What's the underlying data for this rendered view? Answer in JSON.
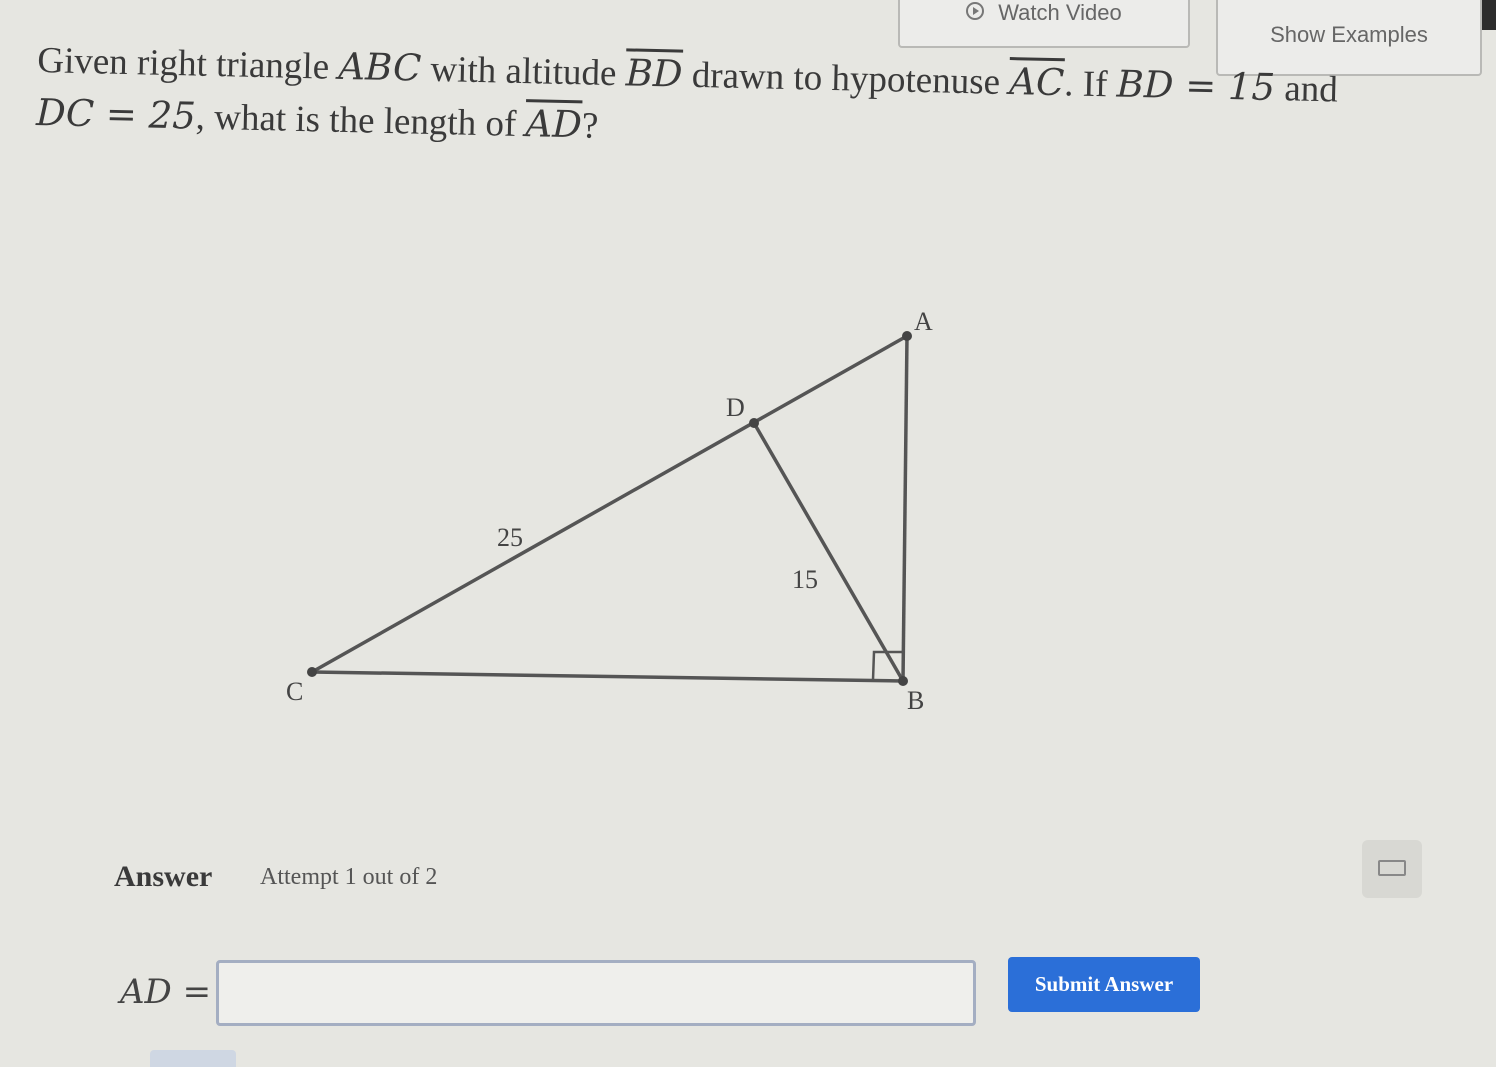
{
  "toolbar": {
    "watch_video_label": "Watch Video",
    "show_examples_label": "Show Examples"
  },
  "question": {
    "t1": "Given right triangle ",
    "m_abc": "ABC",
    "t2": " with altitude ",
    "m_bd": "BD",
    "t3": " drawn to hypotenuse ",
    "m_ac": "AC",
    "t4": ". If ",
    "m_bd_eq": "BD = 15",
    "t5": " and ",
    "m_dc_eq": "DC = 25",
    "t6": ", what is the length of ",
    "m_ad": "AD",
    "t7": "?"
  },
  "diagram": {
    "points": {
      "A": "A",
      "B": "B",
      "C": "C",
      "D": "D"
    },
    "lengths": {
      "dc": "25",
      "bd": "15"
    }
  },
  "answer": {
    "label": "Answer",
    "attempt": "Attempt 1 out of 2",
    "ad_label": "AD =",
    "input_value": "",
    "submit_label": "Submit Answer"
  },
  "colors": {
    "submit_bg": "#2b6fd8",
    "background": "#e6e6e1",
    "line": "#555555"
  },
  "icons": {
    "watch": "play-circle-icon",
    "keyboard": "keyboard-icon"
  }
}
